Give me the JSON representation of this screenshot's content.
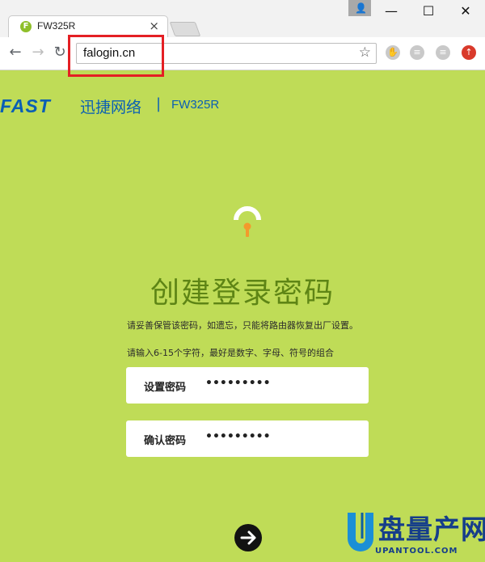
{
  "browser": {
    "tab_title": "FW325R",
    "tab_favicon": "F",
    "tab_close": "×",
    "url": "falogin.cn",
    "window": {
      "minimize": "—",
      "maximize": "☐",
      "close": "✕"
    },
    "nav": {
      "back": "←",
      "forward": "→",
      "reload": "↻"
    },
    "bookmark_icon": "☆"
  },
  "brand": {
    "logo": "FAST",
    "name_cn": "迅捷网络",
    "separator": "|",
    "model": "FW325R",
    "color": "#0a5fb4"
  },
  "page": {
    "heading": "创建登录密码",
    "subtitle": "请妥善保管该密码，如遗忘，只能将路由器恢复出厂设置。",
    "hint": "请输入6-15个字符，最好是数字、字母、符号的组合",
    "fields": [
      {
        "label": "设置密码",
        "value": "•••••••••"
      },
      {
        "label": "确认密码",
        "value": "•••••••••"
      }
    ],
    "next_icon": "arrow-right-icon",
    "background": "#bfdc57",
    "accent": "#5e8515"
  },
  "watermark": {
    "text": "盘量产网",
    "url": "UPANTOOL.COM"
  }
}
